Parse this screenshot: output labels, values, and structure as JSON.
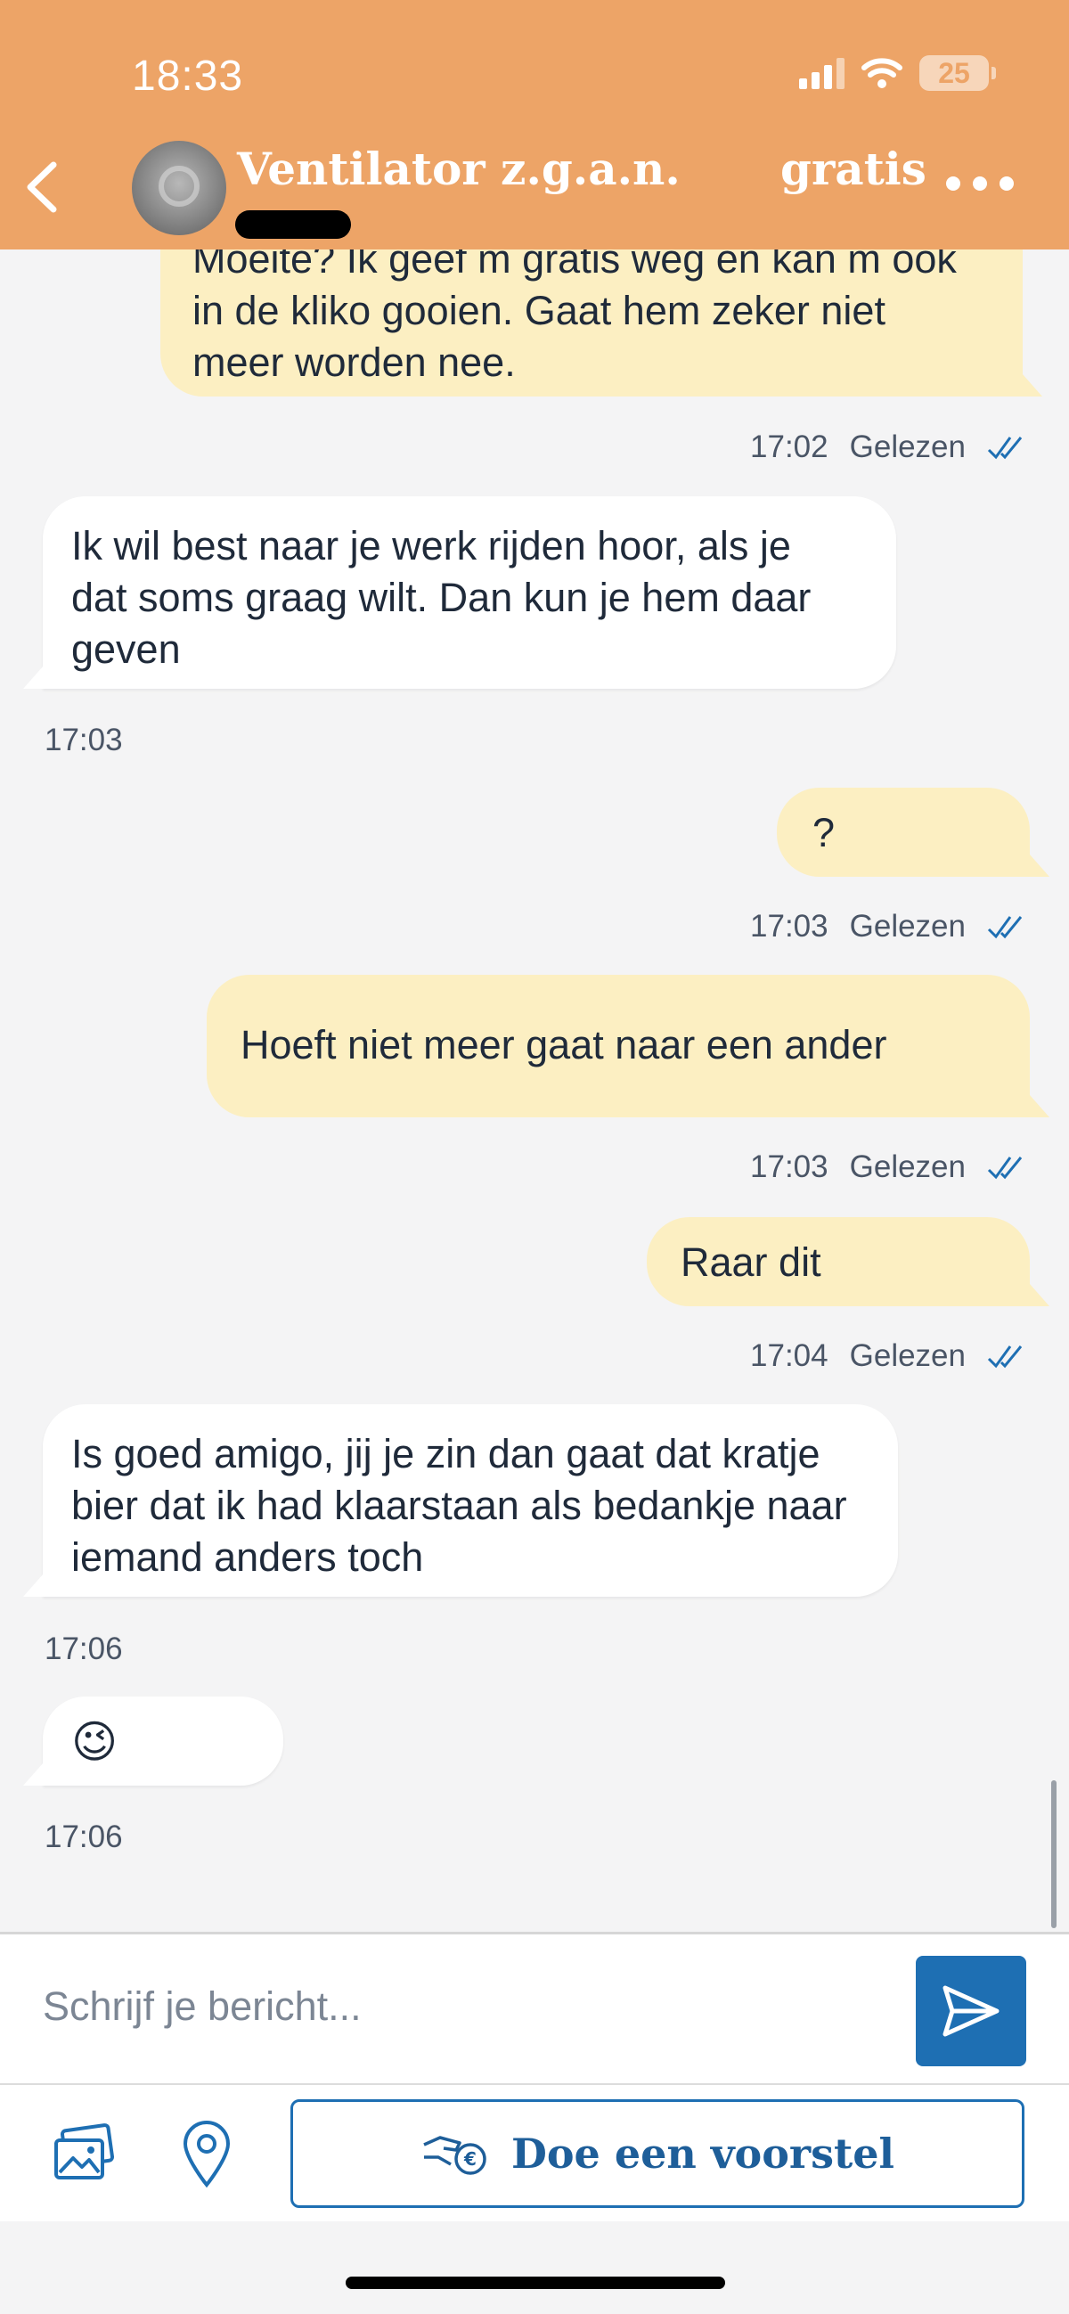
{
  "status_bar": {
    "time": "18:33",
    "battery": "25"
  },
  "header": {
    "title": "Ventilator z.g.a.n.",
    "price": "gratis"
  },
  "messages": [
    {
      "direction": "out",
      "text": "Moeite? Ik geef m gratis weg en kan m ook in de kliko gooien. Gaat hem zeker niet meer worden nee.",
      "time": "17:02",
      "status": "Gelezen"
    },
    {
      "direction": "in",
      "text": "Ik wil best naar je werk rijden hoor, als je dat soms graag wilt. Dan kun je hem daar geven",
      "time": "17:03"
    },
    {
      "direction": "out",
      "text": "?",
      "time": "17:03",
      "status": "Gelezen"
    },
    {
      "direction": "out",
      "text": "Hoeft niet meer gaat naar een ander",
      "time": "17:03",
      "status": "Gelezen"
    },
    {
      "direction": "out",
      "text": "Raar dit",
      "time": "17:04",
      "status": "Gelezen"
    },
    {
      "direction": "in",
      "text": "Is goed amigo, jij je zin dan gaat dat kratje bier dat ik had klaarstaan als bedankje naar iemand anders toch",
      "time": "17:06"
    },
    {
      "direction": "in",
      "text": "😉",
      "time": "17:06"
    }
  ],
  "composer": {
    "placeholder": "Schrijf je bericht..."
  },
  "actions": {
    "offer_label": "Doe een voorstel"
  },
  "colors": {
    "header": "#eda467",
    "outgoing_bubble": "#fcefc2",
    "incoming_bubble": "#ffffff",
    "accent_blue": "#1e6fb3"
  }
}
